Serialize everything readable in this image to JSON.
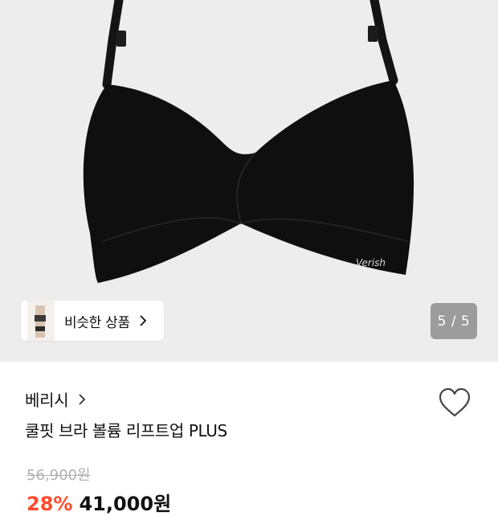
{
  "hero": {
    "product_logo_text": "Verish",
    "similar_products_label": "비슷한 상품",
    "pager": "5 / 5"
  },
  "product": {
    "brand": "베리시",
    "title": "쿨핏 브라 볼륨 리프트업 PLUS",
    "original_price": "56,900원",
    "discount": "28%",
    "sale_price": "41,000원"
  },
  "icons": {
    "brand_arrow": "chevron-right-icon",
    "wishlist": "heart-outline-icon",
    "similar_arrow": "chevron-right-icon"
  },
  "colors": {
    "hero_background": "#ededed",
    "pager_background": "#9c9c9c",
    "discount": "#ff4b2b",
    "strike_price": "#b0b0b0"
  }
}
